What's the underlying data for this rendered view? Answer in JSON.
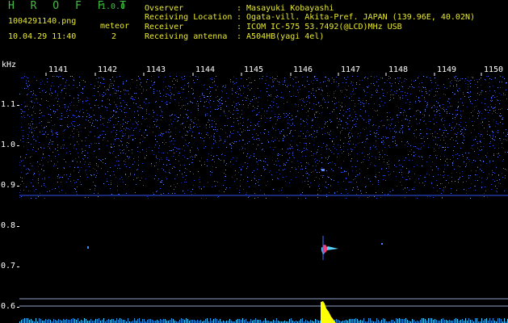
{
  "app": {
    "title": "H R O F F T",
    "version": "1.0.0"
  },
  "file": {
    "name": "1004291140.png",
    "datetime": "10.04.29 11:40"
  },
  "meteor": {
    "label": "meteor",
    "count": "2"
  },
  "info": {
    "labels": [
      "Ovserver",
      "Receiving Location",
      "Receiver",
      "Receiving antenna"
    ],
    "values": [
      ": Masayuki Kobayashi",
      ": Ogata-vill. Akita-Pref. JAPAN (139.96E, 40.02N)",
      ": ICOM IC-575 53.7492(@LCD)MHz USB",
      ": A504HB(yagi 4el)"
    ]
  },
  "axis": {
    "unit": "kHz",
    "y_ticks": [
      "1.1",
      "1.0",
      "0.9",
      "0.8",
      "0.7",
      "0.6"
    ],
    "x_ticks": [
      "1141",
      "1142",
      "1143",
      "1144",
      "1145",
      "1146",
      "1147",
      "1148",
      "1149",
      "1150"
    ]
  },
  "colors": {
    "noise": "#2a3dff",
    "text_yellow": "#e8e830",
    "title_green": "#3fbf3f",
    "lines": "#8fa0c8"
  }
}
